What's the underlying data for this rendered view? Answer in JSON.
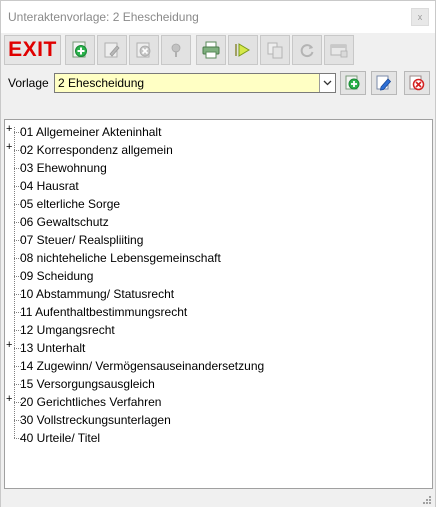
{
  "window": {
    "title": "Unteraktenvorlage: 2 Ehescheidung",
    "close_glyph": "x"
  },
  "toolbar": {
    "exit_label": "EXIT",
    "buttons": [
      {
        "name": "add-button",
        "icon": "add-green-plus-icon"
      },
      {
        "name": "edit-button",
        "icon": "edit-pencil-icon"
      },
      {
        "name": "delete-button",
        "icon": "delete-icon"
      },
      {
        "name": "info-button",
        "icon": "info-icon"
      },
      {
        "name": "print-button",
        "icon": "printer-icon"
      },
      {
        "name": "run-button",
        "icon": "play-icon"
      },
      {
        "name": "copy-button",
        "icon": "copy-icon"
      },
      {
        "name": "refresh-button",
        "icon": "refresh-icon"
      },
      {
        "name": "window-button",
        "icon": "window-icon"
      }
    ]
  },
  "vorlage": {
    "label": "Vorlage",
    "selected": "2 Ehescheidung"
  },
  "colors": {
    "exit_red": "#e00000",
    "select_bg": "#ffffc4",
    "add_green": "#22a84a",
    "edit_blue": "#2d6fd6",
    "delete_red": "#d42020"
  },
  "tree": {
    "items": [
      {
        "label": "01 Allgemeiner Akteninhalt",
        "expandable": true
      },
      {
        "label": "02 Korrespondenz allgemein",
        "expandable": true
      },
      {
        "label": "03 Ehewohnung",
        "expandable": false
      },
      {
        "label": "04 Hausrat",
        "expandable": false
      },
      {
        "label": "05 elterliche Sorge",
        "expandable": false
      },
      {
        "label": "06 Gewaltschutz",
        "expandable": false
      },
      {
        "label": "07 Steuer/ Realspliiting",
        "expandable": false
      },
      {
        "label": "08 nichteheliche Lebensgemeinschaft",
        "expandable": false
      },
      {
        "label": "09 Scheidung",
        "expandable": false
      },
      {
        "label": "10 Abstammung/ Statusrecht",
        "expandable": false
      },
      {
        "label": "11 Aufenthaltbestimmungsrecht",
        "expandable": false
      },
      {
        "label": "12 Umgangsrecht",
        "expandable": false
      },
      {
        "label": "13 Unterhalt",
        "expandable": true
      },
      {
        "label": "14 Zugewinn/ Vermögensauseinandersetzung",
        "expandable": false
      },
      {
        "label": "15 Versorgungsausgleich",
        "expandable": false
      },
      {
        "label": "20 Gerichtliches Verfahren",
        "expandable": true
      },
      {
        "label": "30 Vollstreckungsunterlagen",
        "expandable": false
      },
      {
        "label": "40 Urteile/ Titel",
        "expandable": false
      }
    ]
  }
}
